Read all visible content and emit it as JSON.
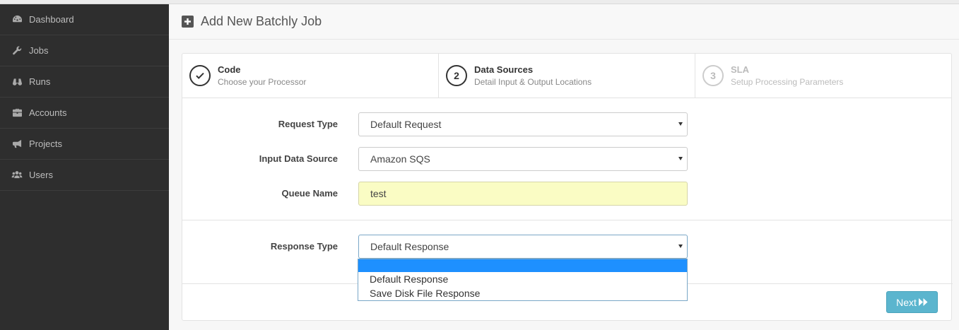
{
  "sidebar": {
    "items": [
      {
        "label": "Dashboard",
        "icon": "dashboard-icon"
      },
      {
        "label": "Jobs",
        "icon": "wrench-icon"
      },
      {
        "label": "Runs",
        "icon": "binoculars-icon"
      },
      {
        "label": "Accounts",
        "icon": "briefcase-icon"
      },
      {
        "label": "Projects",
        "icon": "bullhorn-icon"
      },
      {
        "label": "Users",
        "icon": "users-icon"
      }
    ]
  },
  "header": {
    "title": "Add New Batchly Job",
    "icon": "plus-square-icon"
  },
  "steps": [
    {
      "number": "",
      "title": "Code",
      "subtitle": "Choose your Processor",
      "state": "complete"
    },
    {
      "number": "2",
      "title": "Data Sources",
      "subtitle": "Detail Input & Output Locations",
      "state": "active"
    },
    {
      "number": "3",
      "title": "SLA",
      "subtitle": "Setup Processing Parameters",
      "state": "disabled"
    }
  ],
  "form": {
    "request_type": {
      "label": "Request Type",
      "value": "Default Request"
    },
    "input_source": {
      "label": "Input Data Source",
      "value": "Amazon SQS"
    },
    "queue_name": {
      "label": "Queue Name",
      "value": "test"
    },
    "response_type": {
      "label": "Response Type",
      "value": "Default Response",
      "options": [
        "",
        "Default Response",
        "Save Disk File Response"
      ]
    }
  },
  "actions": {
    "next_label": "Next"
  },
  "colors": {
    "sidebar_bg": "#2e2e2e",
    "accent": "#5bb5ce",
    "highlight": "#1e90ff",
    "autofill": "#fafcc4"
  }
}
